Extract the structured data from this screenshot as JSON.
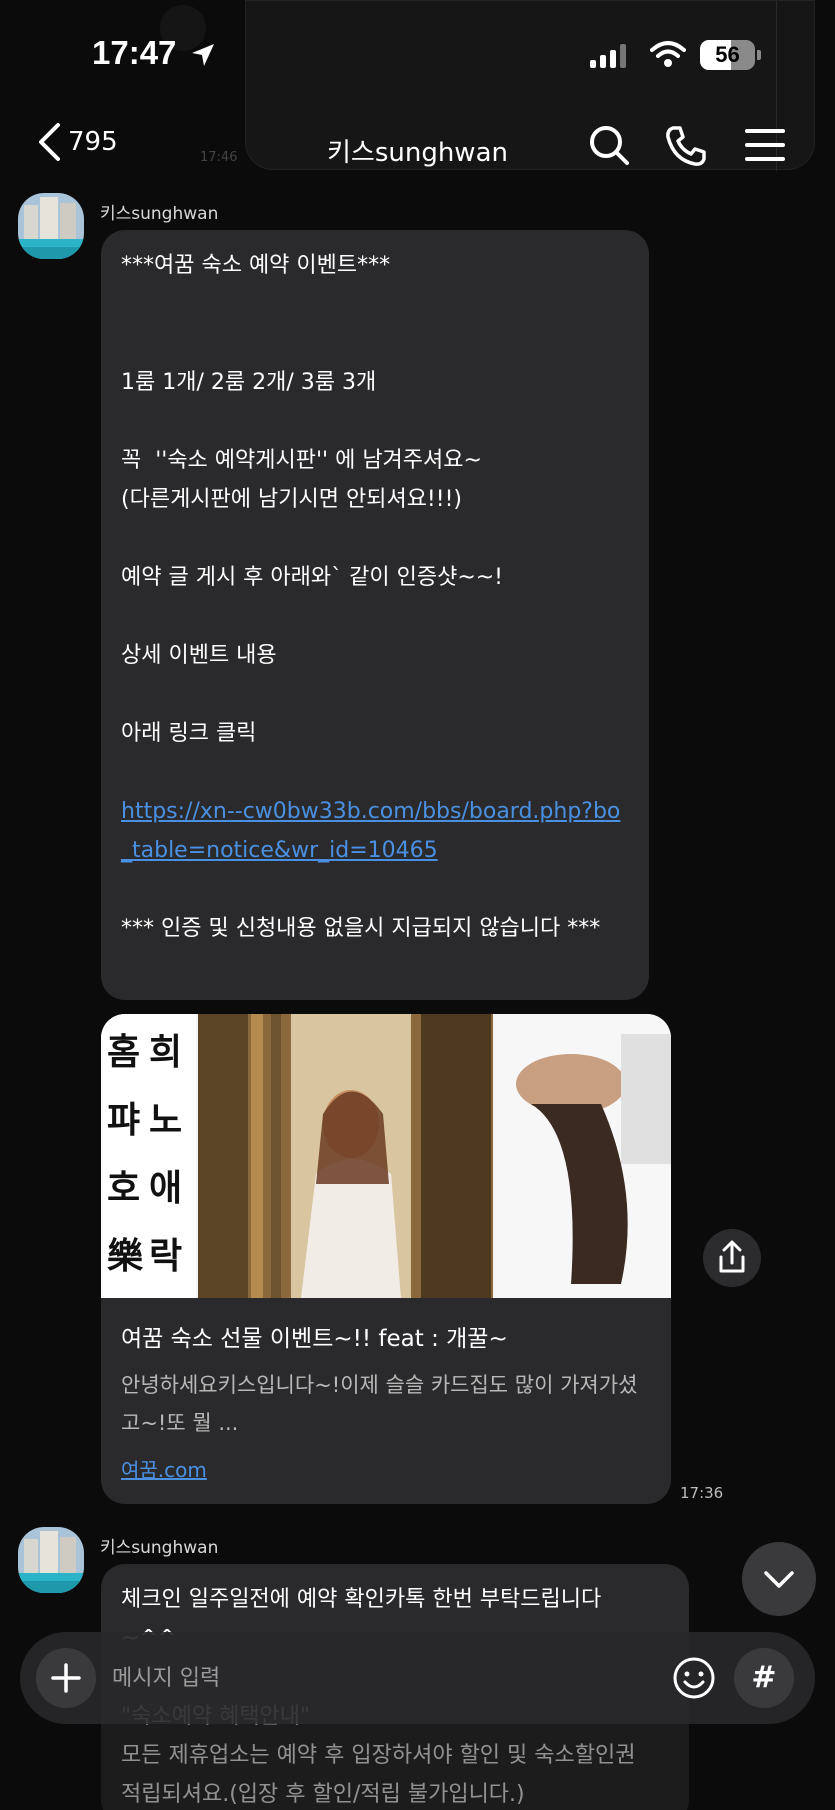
{
  "status_bar": {
    "time": "17:47",
    "battery_level": "56",
    "battery_fraction": 0.56
  },
  "nav": {
    "back_count": "795",
    "title": "키스sunghwan"
  },
  "messages": [
    {
      "sender": "키스sunghwan",
      "lines": [
        "***여꿈 숙소 예약 이벤트***",
        "",
        "",
        "1룸 1개/ 2룸 2개/ 3룸 3개",
        "",
        "꼭  ''숙소 예약게시판'' 에 남겨주셔요~",
        "(다른게시판에 남기시면 안되셔요!!!)",
        "",
        "예약 글 게시 후 아래와` 같이 인증샷~~!",
        "",
        "상세 이벤트 내용",
        "",
        "아래 링크 클릭",
        ""
      ],
      "link": "https://xn--cw0bw33b.com/bbs/board.php?bo_table=notice&wr_id=10465",
      "footer_lines": [
        "",
        "*** 인증 및 신청내용 없을시 지급되지 않습니다 ***"
      ]
    }
  ],
  "card": {
    "image_text_left": "홈퍄호樂",
    "image_text_right": "희노애락",
    "title": "여꿈 숙소 선물 이벤트~!! feat : 개꿀~",
    "description": "안녕하세요키스입니다~!이제 슬슬 카드집도 많이 가져가셨고~!또 뭘 ...",
    "domain": "여꿈.com",
    "time": "17:36"
  },
  "second_message": {
    "sender": "키스sunghwan",
    "lines": [
      "체크인 일주일전에 예약 확인카톡 한번 부탁드립니다",
      "~^^",
      "",
      "\"숙소예약 혜택안내\"",
      "모든 제휴업소는 예약 후 입장하셔야 할인 및 숙소할인권",
      "적립되셔요.(입장 후 할인/적립 불가입니다.)"
    ]
  },
  "ghost_time": "17:46",
  "input": {
    "placeholder": "메시지 입력",
    "hash_label": "#"
  },
  "colors": {
    "background": "#0b0b0b",
    "bubble": "#2a2a2c",
    "link": "#4a90e2"
  }
}
